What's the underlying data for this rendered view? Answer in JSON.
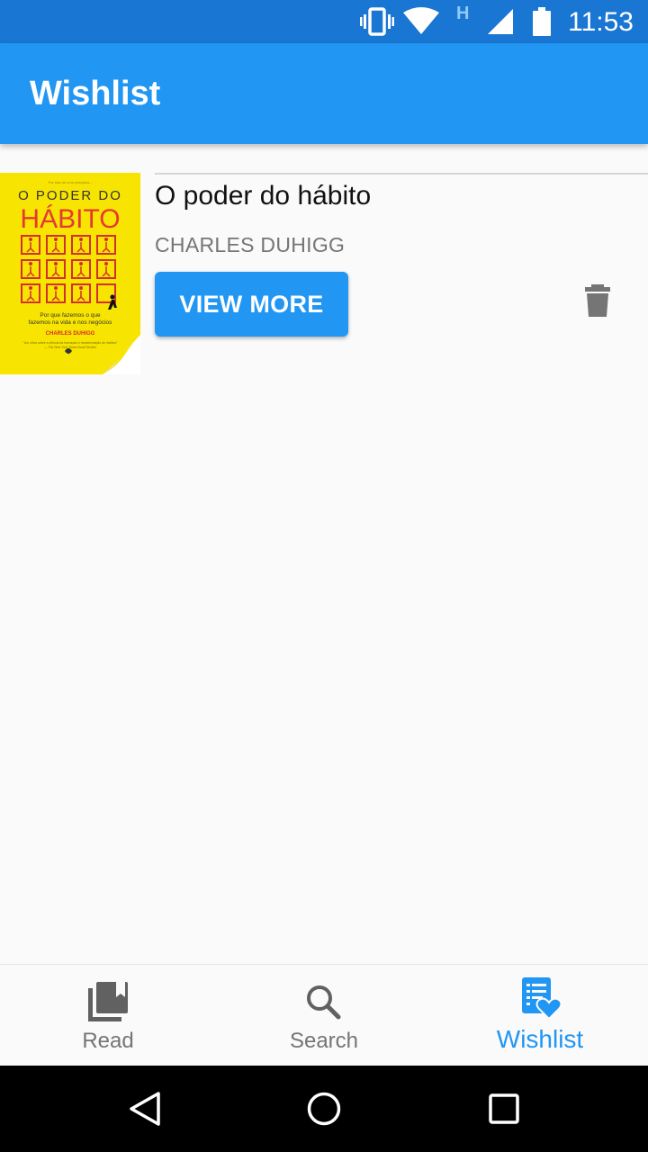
{
  "status_bar": {
    "time": "11:53",
    "network_type": "H",
    "icons": [
      "vibrate-icon",
      "wifi-icon",
      "signal-icon",
      "battery-icon"
    ]
  },
  "app_bar": {
    "title": "Wishlist"
  },
  "wishlist": {
    "items": [
      {
        "title": "O poder do hábito",
        "author": "CHARLES DUHIGG",
        "action_label": "VIEW MORE",
        "cover": {
          "top_line": "O PODER DO",
          "main_word": "HÁBITO",
          "subtitle_1": "Por que fazemos o que",
          "subtitle_2": "fazemos na vida e nos negócios",
          "author": "CHARLES DUHIGG",
          "color": "#f7e400"
        }
      }
    ]
  },
  "bottom_nav": {
    "items": [
      {
        "label": "Read",
        "icon": "library-books-icon",
        "active": false
      },
      {
        "label": "Search",
        "icon": "search-icon",
        "active": false
      },
      {
        "label": "Wishlist",
        "icon": "wishlist-heart-icon",
        "active": true
      }
    ]
  },
  "colors": {
    "primary": "#2196f3",
    "primary_dark": "#1976d2",
    "inactive": "#757575",
    "background": "#fafafa"
  }
}
